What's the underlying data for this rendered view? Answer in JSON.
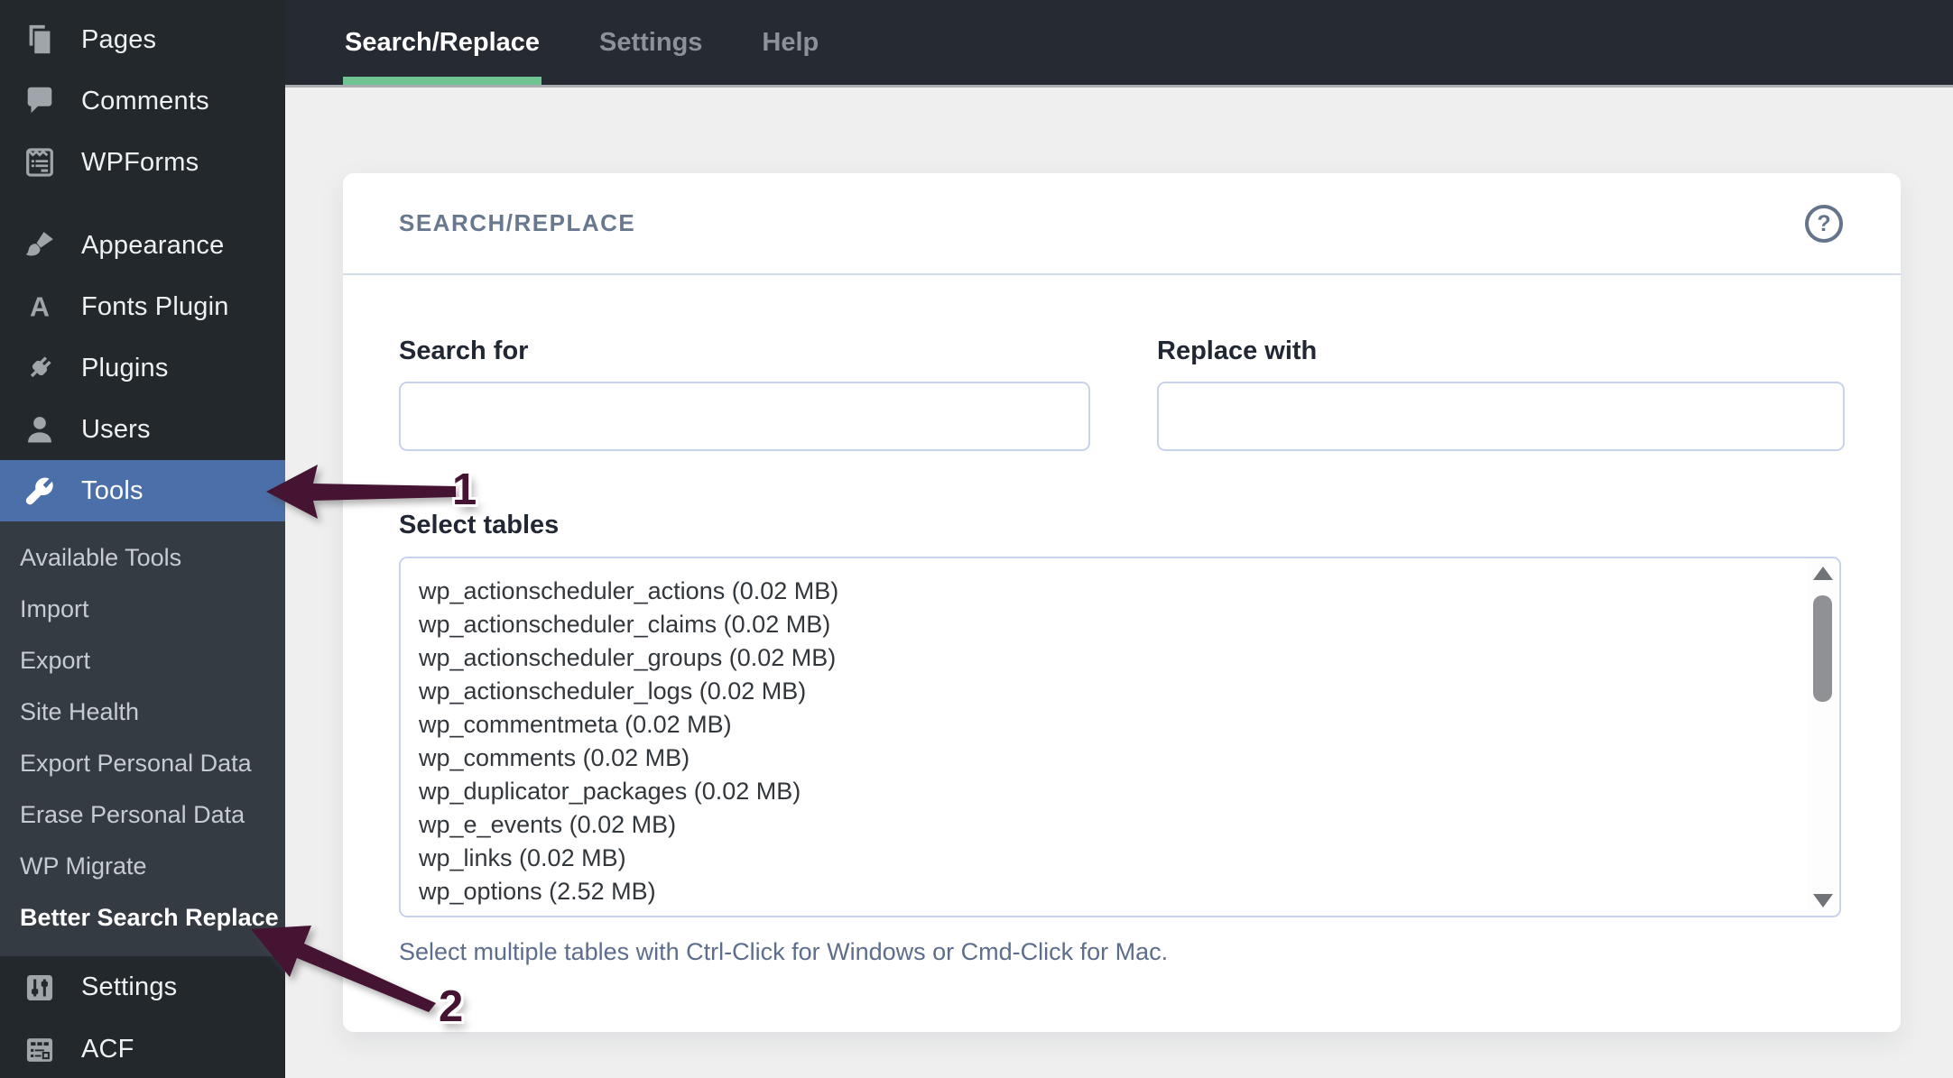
{
  "sidebar": {
    "items_top": [
      {
        "label": "Pages"
      },
      {
        "label": "Comments"
      },
      {
        "label": "WPForms"
      },
      {
        "label": "Appearance"
      },
      {
        "label": "Fonts Plugin"
      },
      {
        "label": "Plugins"
      },
      {
        "label": "Users"
      },
      {
        "label": "Tools"
      }
    ],
    "submenu": [
      {
        "label": "Available Tools"
      },
      {
        "label": "Import"
      },
      {
        "label": "Export"
      },
      {
        "label": "Site Health"
      },
      {
        "label": "Export Personal Data"
      },
      {
        "label": "Erase Personal Data"
      },
      {
        "label": "WP Migrate"
      },
      {
        "label": "Better Search Replace"
      }
    ],
    "items_bottom": [
      {
        "label": "Settings"
      },
      {
        "label": "ACF"
      }
    ]
  },
  "header": {
    "tabs": [
      {
        "label": "Search/Replace"
      },
      {
        "label": "Settings"
      },
      {
        "label": "Help"
      }
    ]
  },
  "panel": {
    "title": "SEARCH/REPLACE"
  },
  "form": {
    "search": {
      "label": "Search for",
      "value": ""
    },
    "replace": {
      "label": "Replace with",
      "value": ""
    },
    "tables": {
      "label": "Select tables",
      "options": [
        "wp_actionscheduler_actions (0.02 MB)",
        "wp_actionscheduler_claims (0.02 MB)",
        "wp_actionscheduler_groups (0.02 MB)",
        "wp_actionscheduler_logs (0.02 MB)",
        "wp_commentmeta (0.02 MB)",
        "wp_comments (0.02 MB)",
        "wp_duplicator_packages (0.02 MB)",
        "wp_e_events (0.02 MB)",
        "wp_links (0.02 MB)",
        "wp_options (2.52 MB)"
      ],
      "note": "Select multiple tables with Ctrl-Click for Windows or Cmd-Click for Mac."
    }
  },
  "annotations": {
    "step1": "1",
    "step2": "2"
  },
  "colors": {
    "sidebar_bg": "#23282d",
    "submenu_bg": "#353b42",
    "active_item_bg": "#4b6fa8",
    "header_bg": "#262b33",
    "tab_active_underline": "#6fc292",
    "content_bg": "#efefef",
    "panel_title": "#68788f",
    "annotation_arrow": "#451433"
  }
}
